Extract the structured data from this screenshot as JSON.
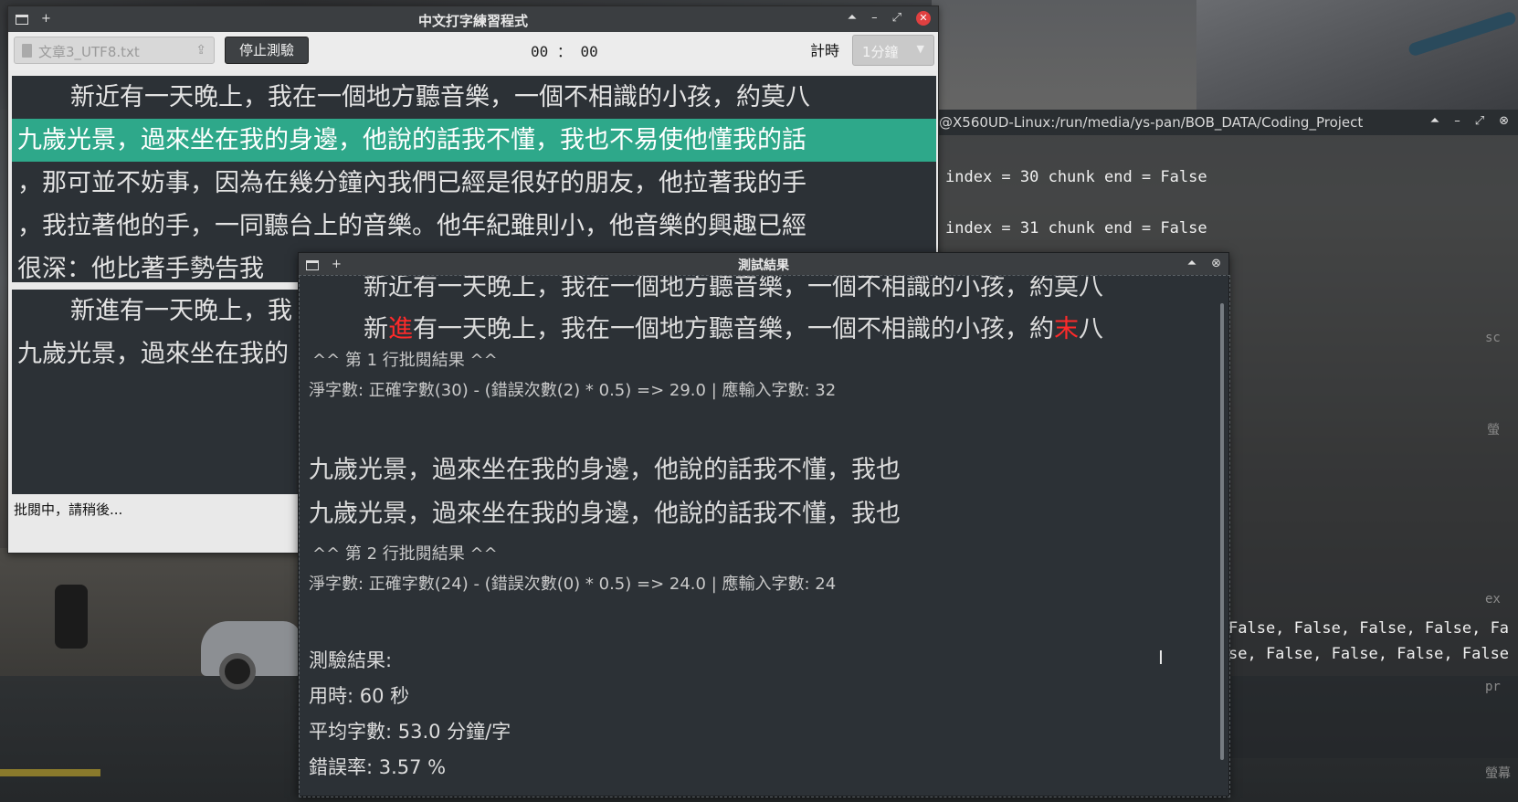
{
  "main_window": {
    "title": "中文打字練習程式",
    "file_name": "文章3_UTF8.txt",
    "stop_button": "停止測驗",
    "timer": "00 ： 00",
    "timer_label": "計時",
    "duration_selected": "1分鐘",
    "reference_lines": [
      "新近有一天晚上，我在一個地方聽音樂，一個不相識的小孩，約莫八",
      "九歲光景，過來坐在我的身邊，他說的話我不懂，我也不易使他懂我的話",
      "，那可並不妨事，因為在幾分鐘內我們已經是很好的朋友，他拉著我的手",
      "，我拉著他的手，一同聽台上的音樂。他年紀雖則小，他音樂的興趣已經",
      "很深：他比著手勢告我"
    ],
    "typed_lines": [
      "新進有一天晚上，我",
      "九歲光景，過來坐在我的"
    ],
    "status": "批閱中，請稍後..."
  },
  "terminal": {
    "title": "@X560UD-Linux:/run/media/ys-pan/BOB_DATA/Coding_Project",
    "lines": [
      "index = 30 chunk end = False",
      "index = 31 chunk end = False",
      "False, False, False, False, Fa",
      "se, False, False, False, False"
    ],
    "side_fragments": [
      "sc",
      "螢",
      "ex",
      "pr",
      "螢幕"
    ]
  },
  "result_window": {
    "title": "測試結果",
    "line1_reference": "新近有一天晚上，我在一個地方聽音樂，一個不相識的小孩，約莫八",
    "line1_typed": {
      "before_err1": "新",
      "err1": "進",
      "middle": "有一天晚上，我在一個地方聽音樂，一個不相識的小孩，約",
      "err2": "末",
      "after_err2": "八"
    },
    "line1_header": "^^ 第 1 行批閱結果 ^^",
    "line1_score": "淨字數: 正確字數(30) - (錯誤次數(2) * 0.5) => 29.0 | 應輸入字數: 32",
    "line2_reference": "九歲光景，過來坐在我的身邊，他說的話我不懂，我也",
    "line2_typed": "九歲光景，過來坐在我的身邊，他說的話我不懂，我也",
    "line2_header": "^^ 第 2 行批閱結果 ^^",
    "line2_score": "淨字數: 正確字數(24) - (錯誤次數(0) * 0.5) => 24.0 | 應輸入字數: 24",
    "summary_title": "測驗結果:",
    "time_used": "用時: 60 秒",
    "avg_speed": "平均字數: 53.0 分鐘/字",
    "error_rate": "錯誤率: 3.57 %"
  },
  "colors": {
    "highlight": "#2ea88a",
    "error": "#ff2a2a",
    "panel_bg": "#2c3136",
    "titlebar": "#3b3e41"
  }
}
